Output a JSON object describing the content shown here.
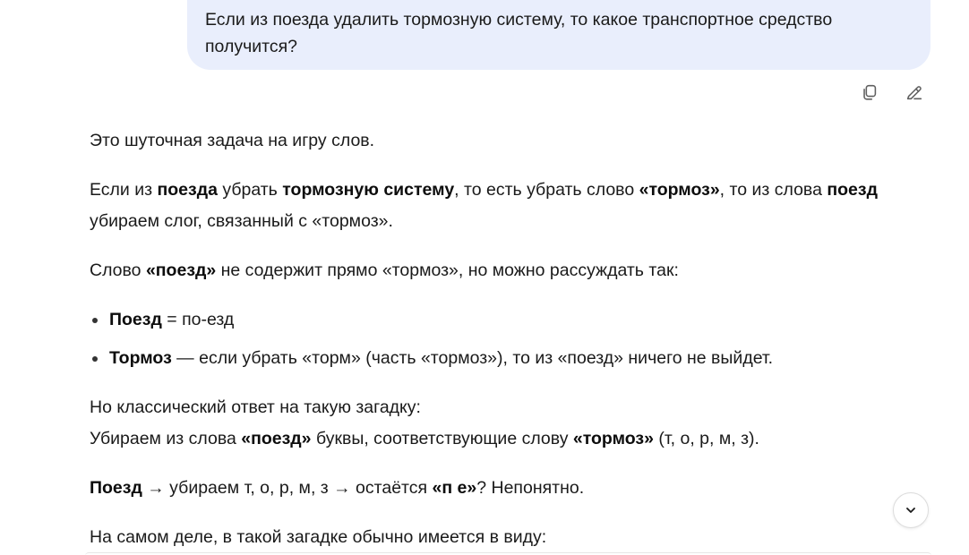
{
  "user_message": {
    "text": "Если из поезда удалить тормозную систему, то какое транспортное средство получится?"
  },
  "message_actions": {
    "copy_icon": "copy-icon",
    "edit_icon": "edit-icon"
  },
  "answer": {
    "p1": "Это шуточная задача на игру слов.",
    "p2": {
      "t1": "Если из ",
      "b1": "поезда",
      "t2": " убрать ",
      "b2": "тормозную систему",
      "t3": ", то есть убрать слово ",
      "b3": "«тормоз»",
      "t4": ", то из слова ",
      "b4": "поезд",
      "t5": " убираем слог, связанный с «тормоз»."
    },
    "p3": {
      "t1": "Слово ",
      "b1": "«поезд»",
      "t2": " не содержит прямо «тормоз», но можно рассуждать так:"
    },
    "bullets": [
      {
        "b": "Поезд",
        "t": " = по-езд"
      },
      {
        "b": "Тормоз",
        "t": " — если убрать «торм» (часть «тормоз»), то из «поезд» ничего не выйдет."
      }
    ],
    "p4": {
      "line1": "Но классический ответ на такую загадку:",
      "t1": "Убираем из слова ",
      "b1": "«поезд»",
      "t2": " буквы, соответствующие слову ",
      "b2": "«тормоз»",
      "t3": " (т, о, р, м, з)."
    },
    "p5": {
      "b1": "Поезд",
      "t1": " → убираем т, о, р, м, з → остаётся ",
      "b2": "«п е»",
      "t2": "? Непонятно."
    },
    "p6": "На самом деле, в такой загадке обычно имеется в виду:"
  },
  "scroll_down_icon": "chevron-down-icon"
}
